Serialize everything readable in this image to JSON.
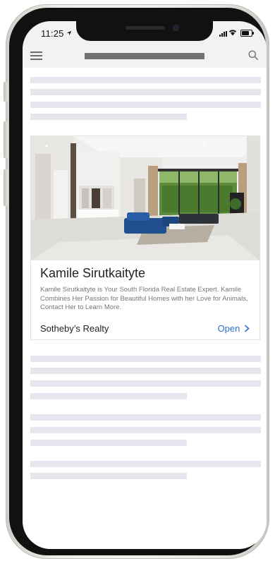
{
  "status_bar": {
    "time": "11:25",
    "location_icon": "location-arrow-icon",
    "signal_icon": "cellular-signal-icon",
    "wifi_icon": "wifi-icon",
    "battery_icon": "battery-icon",
    "battery_level": 0.8
  },
  "nav": {
    "menu_icon": "hamburger-menu-icon",
    "search_icon": "search-icon"
  },
  "card": {
    "image_alt": "Modern living room with blue sofa and glass walls",
    "title": "Kamile Sirutkaityte",
    "description": "Kamile Sirutkaityte is Your South Florida Real Estate Expert. Kamile Combines Her Passion for Beautiful Homes with her Love for Animals, Contact Her to Learn More.",
    "source": "Sotheby’s Realty",
    "cta": "Open",
    "cta_icon": "chevron-right-icon"
  },
  "colors": {
    "skeleton": "#e6e7ee",
    "accent": "#2f6fce",
    "bar": "#f2f2f2"
  }
}
